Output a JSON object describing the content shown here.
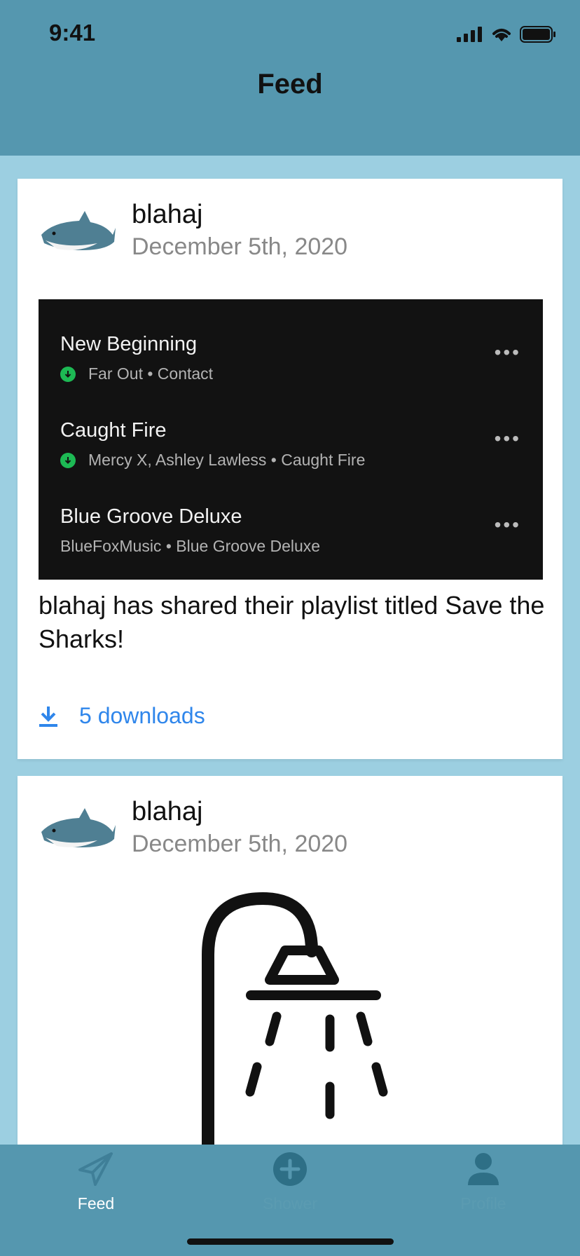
{
  "status_bar": {
    "time": "9:41"
  },
  "nav": {
    "title": "Feed"
  },
  "posts": [
    {
      "username": "blahaj",
      "date": "December 5th, 2020",
      "playlist": [
        {
          "title": "New Beginning",
          "meta": "Far Out • Contact",
          "downloaded": true
        },
        {
          "title": "Caught Fire",
          "meta": "Mercy X, Ashley Lawless • Caught Fire",
          "downloaded": true
        },
        {
          "title": "Blue Groove Deluxe",
          "meta": "BlueFoxMusic • Blue Groove Deluxe",
          "downloaded": false
        }
      ],
      "text": "blahaj has shared their playlist titled Save the Sharks!",
      "downloads_label": "5 downloads"
    },
    {
      "username": "blahaj",
      "date": "December 5th, 2020",
      "image_icon": "shower-icon"
    }
  ],
  "tabs": [
    {
      "label": "Feed",
      "icon": "paper-plane-icon",
      "active": true
    },
    {
      "label": "Shower",
      "icon": "plus-circle-icon",
      "active": false
    },
    {
      "label": "Profile",
      "icon": "person-icon",
      "active": false
    }
  ],
  "colors": {
    "header": "#5597af",
    "background": "#9ccfe1",
    "link": "#2f86eb",
    "tab_active": "#ffffff",
    "tab_inactive": "#5b9bb1"
  }
}
